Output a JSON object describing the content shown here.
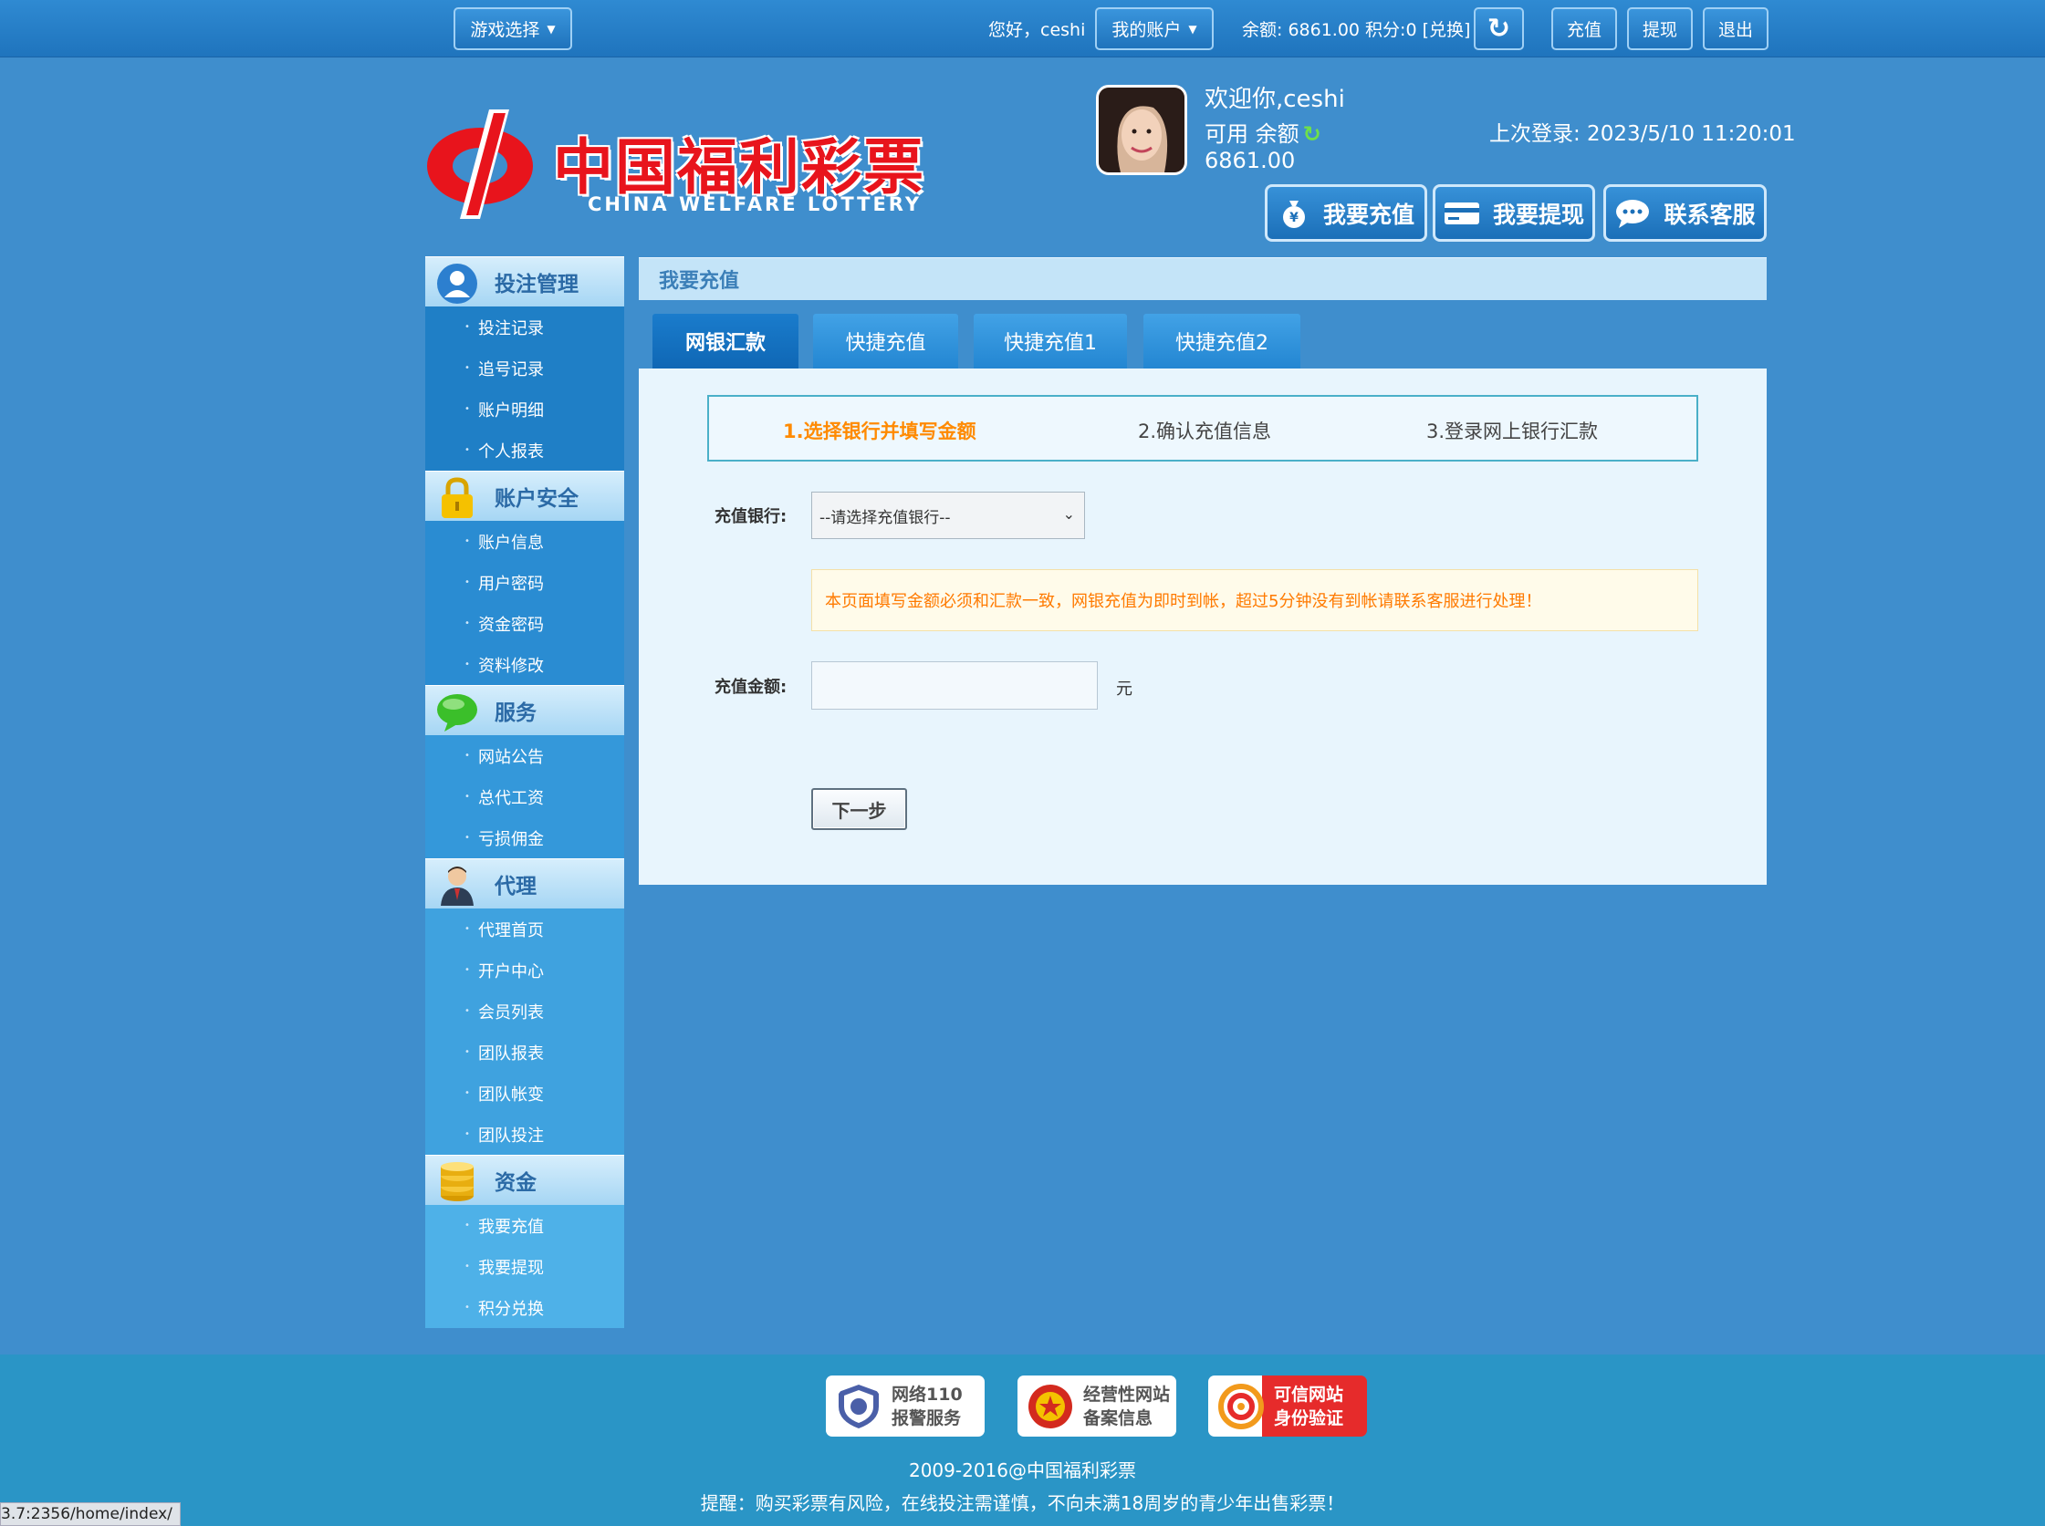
{
  "topbar": {
    "game_select": "游戏选择",
    "greeting": "您好，ceshi",
    "my_account": "我的账户",
    "balance_text": "余额: 6861.00  积分:0 [兑换]",
    "recharge": "充值",
    "withdraw": "提现",
    "logout": "退出"
  },
  "logo": {
    "zh": "中国福利彩票",
    "en": "CHINA WELFARE LOTTERY"
  },
  "user": {
    "welcome": "欢迎你,ceshi",
    "available_label": "可用 余额",
    "available_amount": "6861.00",
    "last_login": "上次登录: 2023/5/10 11:20:01"
  },
  "header_buttons": {
    "recharge": "我要充值",
    "withdraw": "我要提现",
    "service": "联系客服"
  },
  "sidebar": {
    "sections": [
      {
        "title": "投注管理",
        "icon": "user-icon",
        "items": [
          "投注记录",
          "追号记录",
          "账户明细",
          "个人报表"
        ]
      },
      {
        "title": "账户安全",
        "icon": "lock-icon",
        "items": [
          "账户信息",
          "用户密码",
          "资金密码",
          "资料修改"
        ]
      },
      {
        "title": "服务",
        "icon": "chat-bubble-icon",
        "items": [
          "网站公告",
          "总代工资",
          "亏损佣金"
        ]
      },
      {
        "title": "代理",
        "icon": "agent-icon",
        "items": [
          "代理首页",
          "开户中心",
          "会员列表",
          "团队报表",
          "团队帐变",
          "团队投注"
        ]
      },
      {
        "title": "资金",
        "icon": "coins-icon",
        "items": [
          "我要充值",
          "我要提现",
          "积分兑换"
        ]
      }
    ]
  },
  "main": {
    "title": "我要充值",
    "tabs": [
      "网银汇款",
      "快捷充值",
      "快捷充值1",
      "快捷充值2"
    ],
    "steps": [
      "1.选择银行并填写金额",
      "2.确认充值信息",
      "3.登录网上银行汇款"
    ],
    "bank_label": "充值银行:",
    "bank_select": "--请选择充值银行--",
    "notice": "本页面填写金额必须和汇款一致，网银充值为即时到帐，超过5分钟没有到帐请联系客服进行处理！",
    "amount_label": "充值金额:",
    "amount_value": "",
    "unit": "元",
    "next": "下一步"
  },
  "footer": {
    "badges": [
      {
        "line1": "网络110",
        "line2": "报警服务"
      },
      {
        "line1": "经营性网站",
        "line2": "备案信息"
      },
      {
        "line1": "可信网站",
        "line2": "身份验证"
      }
    ],
    "copyright": "2009-2016@中国福利彩票",
    "warning": "提醒：购买彩票有风险，在线投注需谨慎，不向未满18周岁的青少年出售彩票！"
  },
  "status_url": "3.7:2356/home/index/",
  "colors": {
    "page_bg": "#3f8ecd",
    "accent_orange": "#ff8a00",
    "logo_red": "#e8141c"
  }
}
